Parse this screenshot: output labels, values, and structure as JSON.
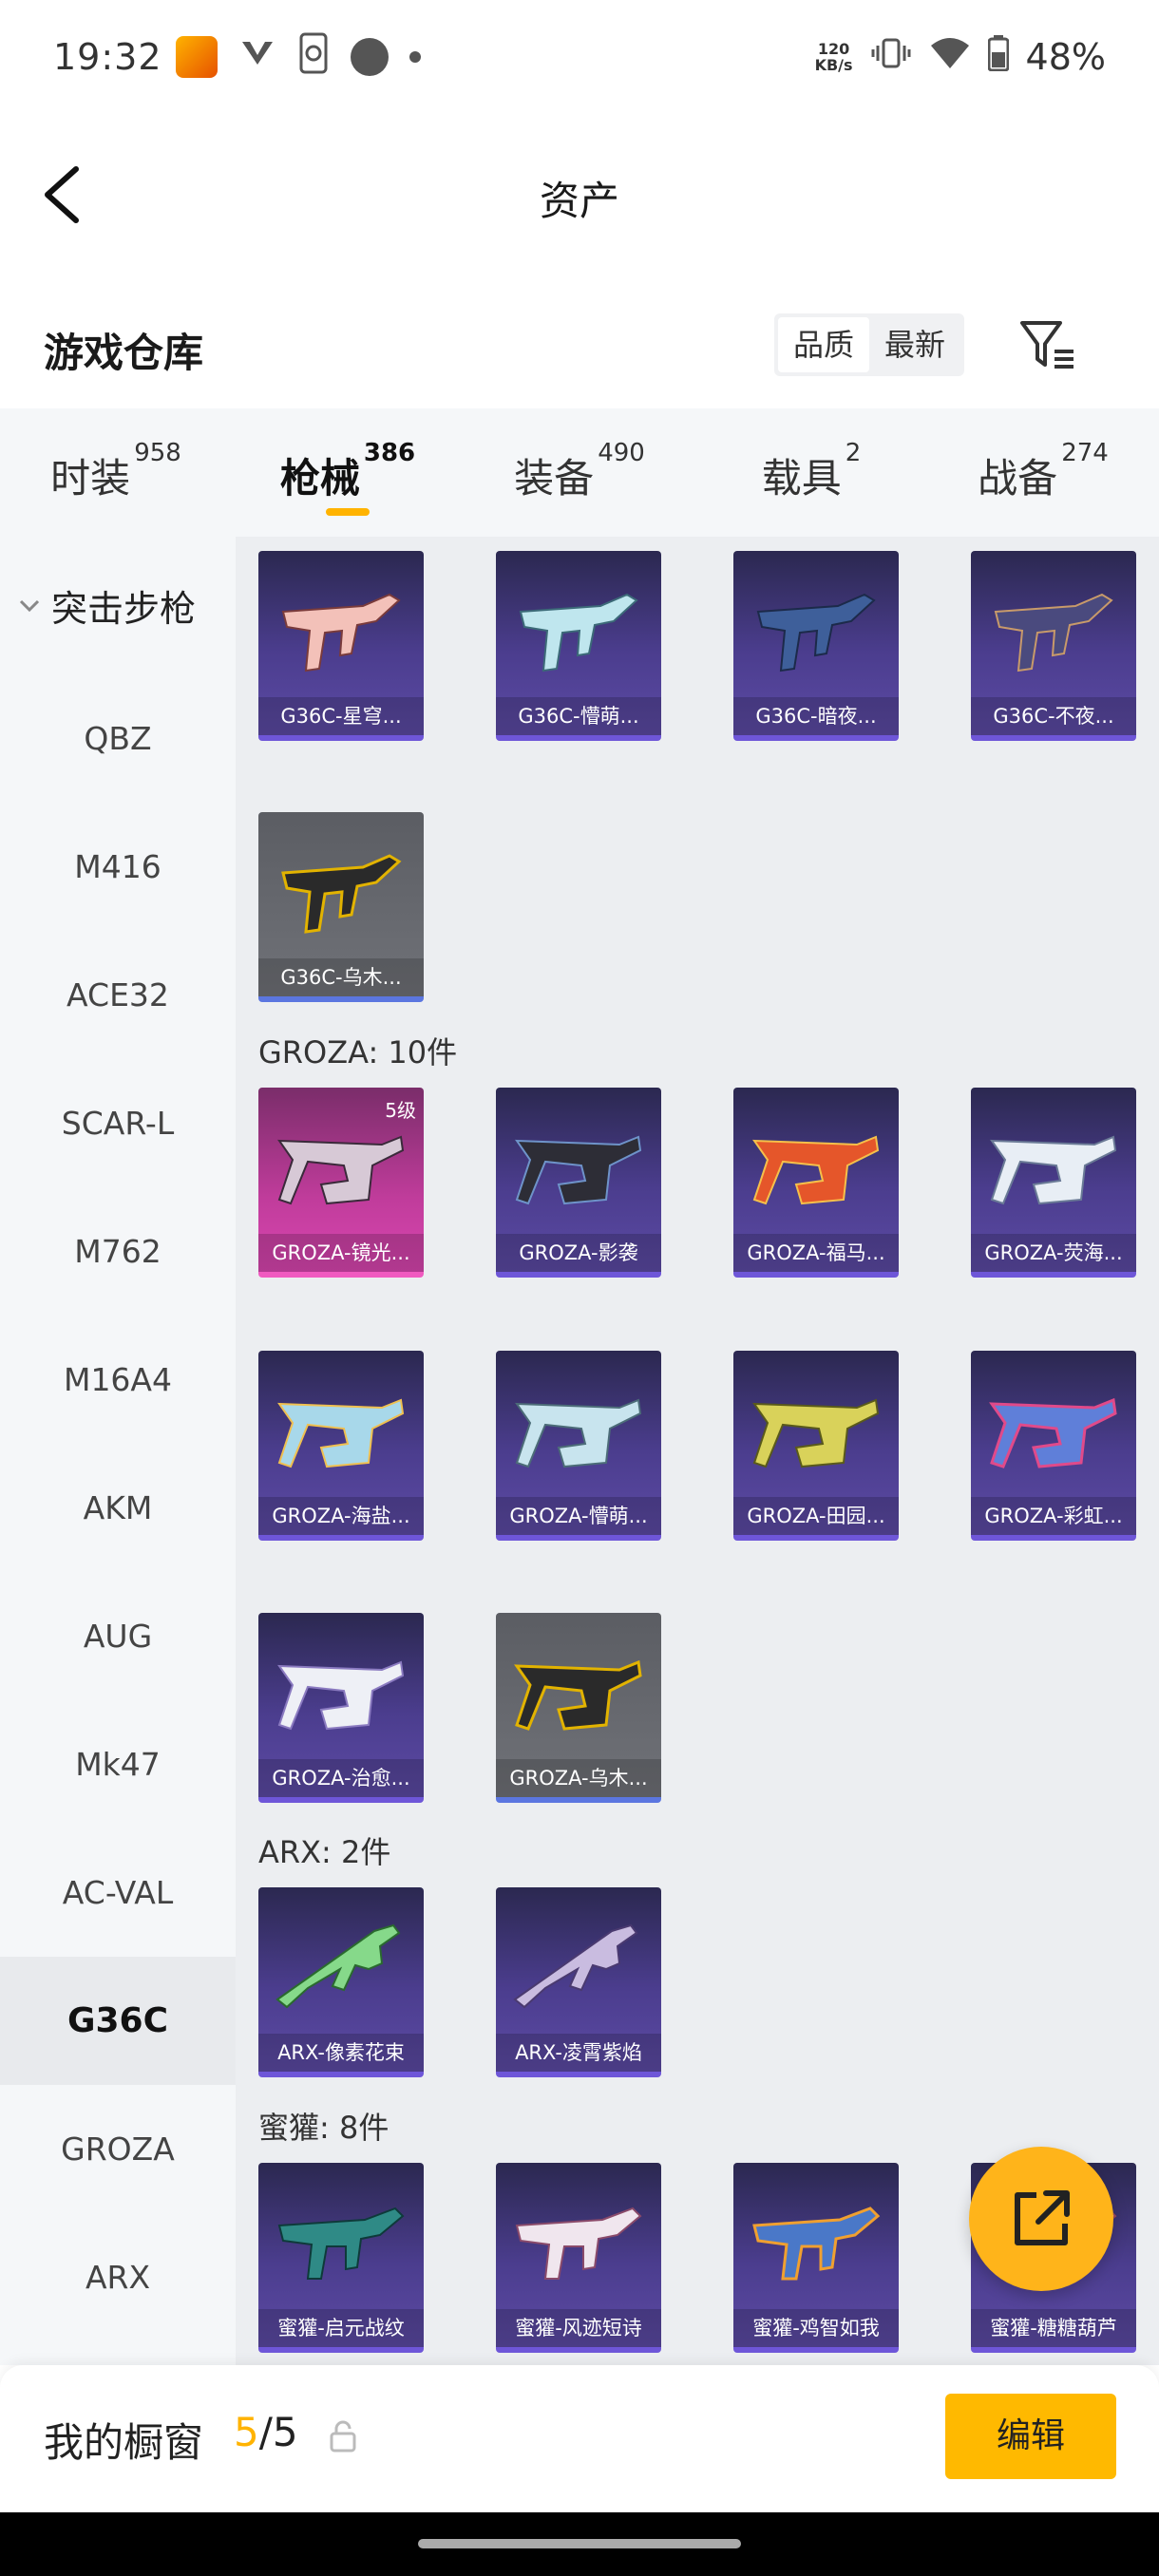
{
  "status_bar": {
    "time": "19:32",
    "net_speed_value": "120",
    "net_speed_unit": "KB/s",
    "battery": "48%",
    "icons": [
      "app-badge-icon",
      "mail-icon",
      "sync-icon",
      "circle-icon",
      "dot-icon",
      "vibrate-icon",
      "wifi-icon",
      "battery-icon"
    ]
  },
  "header": {
    "title": "资产"
  },
  "section": {
    "title": "游戏仓库",
    "sort_options": [
      "品质",
      "最新"
    ],
    "sort_active": "品质"
  },
  "tabs": [
    {
      "label": "时装",
      "count": "958"
    },
    {
      "label": "枪械",
      "count": "386",
      "active": true
    },
    {
      "label": "装备",
      "count": "490"
    },
    {
      "label": "载具",
      "count": "2"
    },
    {
      "label": "战备",
      "count": "274"
    }
  ],
  "sidebar": {
    "category": "突击步枪",
    "items": [
      "QBZ",
      "M416",
      "ACE32",
      "SCAR-L",
      "M762",
      "M16A4",
      "AKM",
      "AUG",
      "Mk47",
      "AC-VAL",
      "G36C",
      "GROZA",
      "ARX"
    ],
    "active": "G36C"
  },
  "groups": {
    "groza_header": "GROZA: 10件",
    "arx_header": "ARX: 2件",
    "honey_header": "蜜獾: 8件"
  },
  "cards": {
    "g36c": [
      "G36C-星穹...",
      "G36C-懵萌...",
      "G36C-暗夜...",
      "G36C-不夜...",
      "G36C-乌木..."
    ],
    "groza": [
      "GROZA-镜光...",
      "GROZA-影袭",
      "GROZA-福马...",
      "GROZA-荧海...",
      "GROZA-海盐...",
      "GROZA-懵萌...",
      "GROZA-田园...",
      "GROZA-彩虹...",
      "GROZA-治愈...",
      "GROZA-乌木..."
    ],
    "groza_level": "5级",
    "arx": [
      "ARX-像素花束",
      "ARX-凌霄紫焰"
    ],
    "honey": [
      "蜜獾-启元战纹",
      "蜜獾-风迹短诗",
      "蜜獾-鸡智如我",
      "蜜獾-糖糖葫芦"
    ]
  },
  "bottom_bar": {
    "showcase_label": "我的橱窗",
    "showcase_used": "5",
    "showcase_total": "/5",
    "edit_label": "编辑"
  },
  "colors": {
    "accent": "#ffb300",
    "card_purple": "#4b3d8e",
    "card_pink": "#c03c9b",
    "card_gray": "#707278"
  }
}
